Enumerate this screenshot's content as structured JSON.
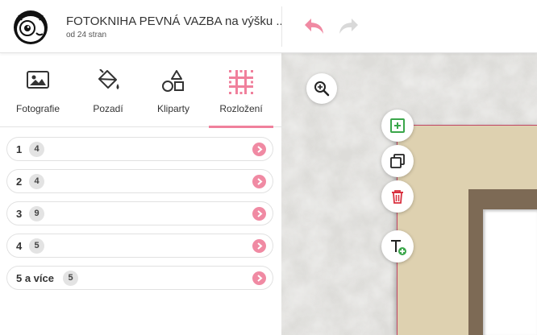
{
  "header": {
    "title": "FOTOKNIHA PEVNÁ VAZBA na výšku ...",
    "subtitle": "od 24 stran",
    "logo_icon": "owl-logo-icon",
    "undo_icon": "undo-icon",
    "redo_icon": "redo-icon"
  },
  "tabs": [
    {
      "label": "Fotografie",
      "icon": "image-icon"
    },
    {
      "label": "Pozadí",
      "icon": "paint-bucket-icon"
    },
    {
      "label": "Kliparty",
      "icon": "shapes-icon"
    },
    {
      "label": "Rozložení",
      "icon": "layout-grid-icon",
      "active": true
    }
  ],
  "layouts": [
    {
      "label": "1",
      "count": "4"
    },
    {
      "label": "2",
      "count": "4"
    },
    {
      "label": "3",
      "count": "9"
    },
    {
      "label": "4",
      "count": "5"
    },
    {
      "label": "5 a více",
      "count": "5"
    }
  ],
  "tools": {
    "zoom_icon": "zoom-in-icon",
    "add_icon": "add-page-icon",
    "duplicate_icon": "duplicate-icon",
    "delete_icon": "trash-icon",
    "add_text_icon": "add-text-icon"
  },
  "colors": {
    "accent": "#f0809c",
    "add_green": "#3aa64a",
    "delete_red": "#d9303f",
    "page_border": "#c24665",
    "page_bg": "#ded1b0"
  }
}
